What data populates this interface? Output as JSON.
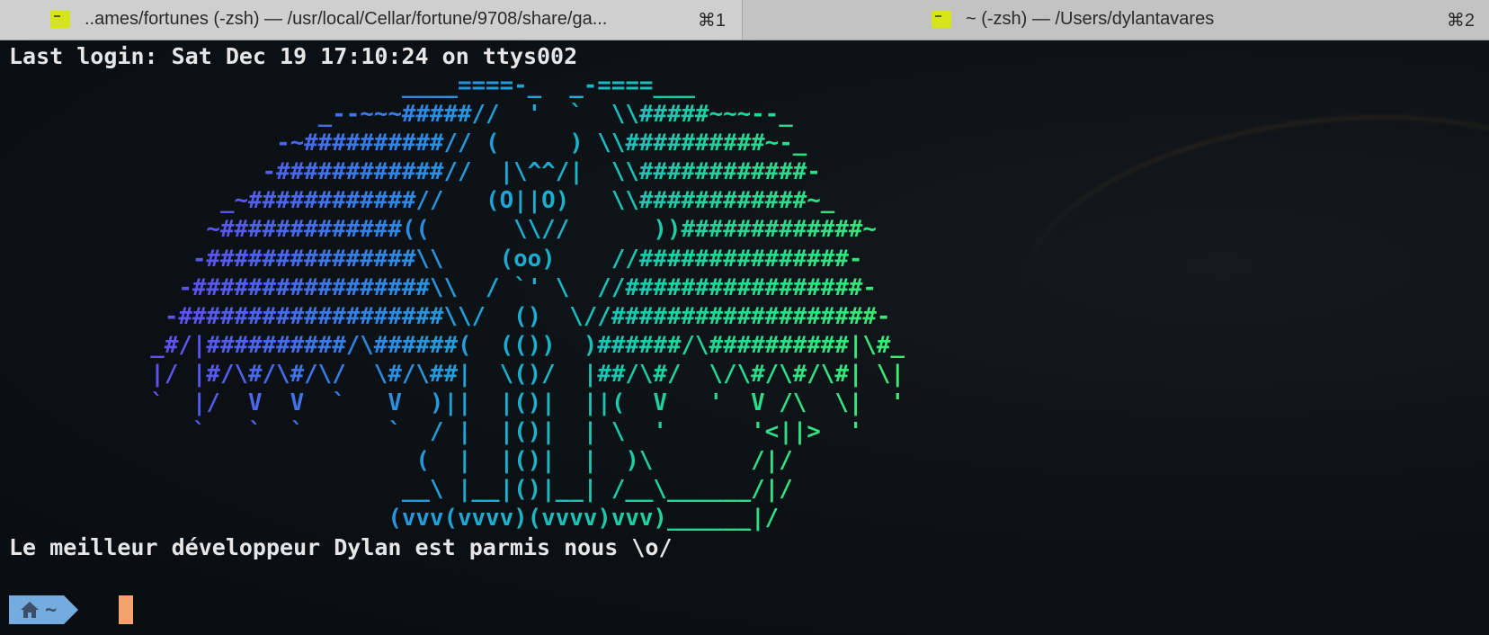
{
  "tabs": [
    {
      "title": "..ames/fortunes (-zsh) — /usr/local/Cellar/fortune/9708/share/ga...",
      "shortcut": "⌘1",
      "icon": "terminal-icon"
    },
    {
      "title": "~ (-zsh) — /Users/dylantavares",
      "shortcut": "⌘2",
      "icon": "terminal-icon"
    }
  ],
  "terminal": {
    "login_line": "Last login: Sat Dec 19 17:10:24 on ttys002",
    "ascii_art": "                            ____====-_  _-====___\n                      _--~~~#####//  '  `  \\\\#####~~~--_\n                   -~##########// (     ) \\\\##########~-_\n                  -############//  |\\^^/|  \\\\############-\n               _~############//   (O||O)   \\\\############~_\n              ~#############((      \\\\//      ))#############~\n             -###############\\\\    (oo)    //###############-\n            -#################\\\\  / `' \\  //#################-\n           -###################\\\\/  ()  \\//###################-\n          _#/|##########/\\######(  (())  )######/\\##########|\\#_\n          |/ |#/\\#/\\#/\\/  \\#/\\##|  \\()/  |##/\\#/  \\/\\#/\\#/\\#| \\|\n          `  |/  V  V  `   V  )||  |()|  ||(  V   '  V /\\  \\|  '\n             `   `  `      `  / |  |()|  | \\  '      '<||>  '\n                             (  |  |()|  |  )\\       /|/\n                            __\\ |__|()|__| /__\\______/|/\n                           (vvv(vvvv)(vvvv)vvv)______|/",
    "fortune_line": "Le meilleur développeur Dylan est parmis nous \\o/",
    "prompt_dir": "~"
  },
  "colors": {
    "tab_bar": "#c9c9c9",
    "terminal_bg": "#0a0f14",
    "text": "#e6e6e6",
    "prompt_segment": "#74acdf",
    "cursor": "#f6a26c",
    "art_gradient_start": "#7a3ef0",
    "art_gradient_end": "#43ee6a"
  }
}
